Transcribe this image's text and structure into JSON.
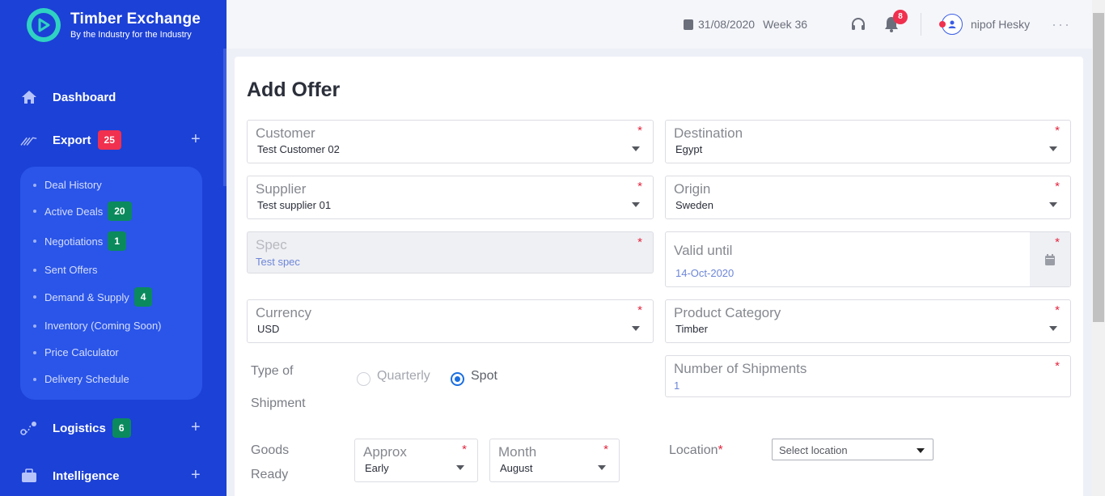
{
  "brand": {
    "title": "Timber Exchange",
    "subtitle": "By the Industry for the Industry"
  },
  "sidebar": {
    "dashboard": "Dashboard",
    "export": {
      "label": "Export",
      "badge": "25"
    },
    "export_items": [
      {
        "label": "Deal History"
      },
      {
        "label": "Active Deals",
        "badge": "20"
      },
      {
        "label": "Negotiations",
        "badge": "1"
      },
      {
        "label": "Sent Offers"
      },
      {
        "label": "Demand & Supply",
        "badge": "4"
      },
      {
        "label": "Inventory (Coming Soon)"
      },
      {
        "label": "Price Calculator"
      },
      {
        "label": "Delivery Schedule"
      }
    ],
    "logistics": {
      "label": "Logistics",
      "badge": "6"
    },
    "intelligence": {
      "label": "Intelligence"
    },
    "plus": "+"
  },
  "header": {
    "date": "31/08/2020",
    "week": "Week 36",
    "notifications": "8",
    "user": "nipof Hesky",
    "more": "···"
  },
  "page": {
    "title": "Add Offer"
  },
  "form": {
    "required_mark": "*",
    "customer": {
      "label": "Customer",
      "value": "Test Customer 02"
    },
    "destination": {
      "label": "Destination",
      "value": "Egypt"
    },
    "supplier": {
      "label": "Supplier",
      "value": "Test supplier 01"
    },
    "origin": {
      "label": "Origin",
      "value": "Sweden"
    },
    "spec": {
      "label": "Spec",
      "value": "Test spec"
    },
    "valid_until": {
      "label": "Valid until",
      "value": "14-Oct-2020"
    },
    "currency": {
      "label": "Currency",
      "value": "USD"
    },
    "product_category": {
      "label": "Product Category",
      "value": "Timber"
    },
    "type_of_shipment": {
      "label_line1": "Type of",
      "label_line2": "Shipment",
      "options": [
        "Quarterly",
        "Spot"
      ],
      "selected": "Spot"
    },
    "number_of_shipments": {
      "label": "Number of Shipments",
      "value": "1"
    },
    "goods_ready": {
      "label_line1": "Goods",
      "label_line2": "Ready"
    },
    "approx": {
      "label": "Approx",
      "value": "Early"
    },
    "month": {
      "label": "Month",
      "value": "August"
    },
    "location": {
      "label": "Location",
      "placeholder": "Select location"
    }
  },
  "colors": {
    "sidebar": "#1c41d6",
    "accent_red": "#f0304e",
    "badge_green": "#0b8a5e",
    "radio_blue": "#1b6fe0"
  }
}
